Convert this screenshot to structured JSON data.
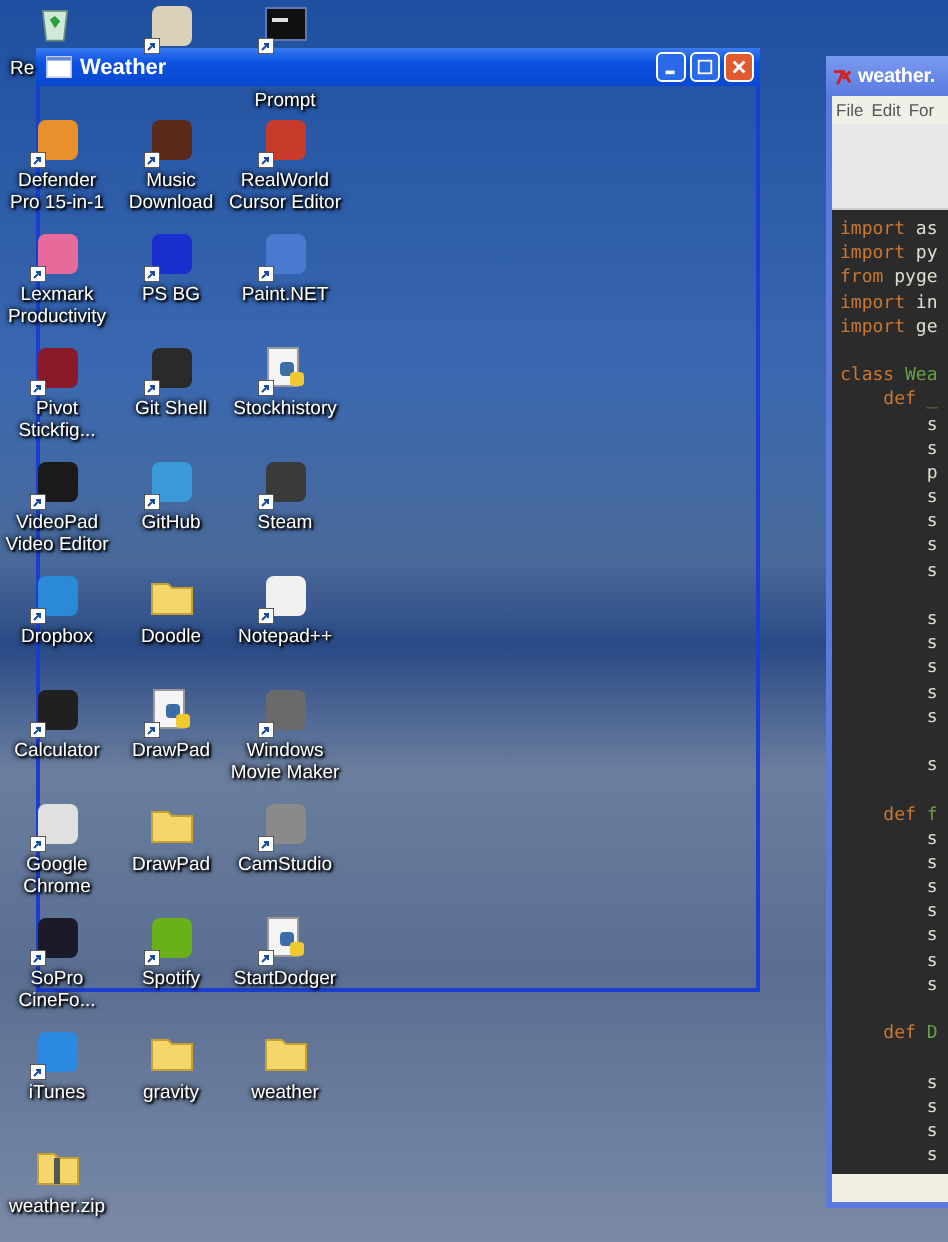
{
  "desktop": {
    "icons": [
      {
        "kind": "bin",
        "label": "Re"
      },
      {
        "kind": "app",
        "color": "#d9d2b8",
        "shortcut": true
      },
      {
        "kind": "console",
        "label": "Prompt",
        "shortcut": true
      },
      {
        "kind": "app",
        "label": "Defender Pro 15-in-1",
        "color": "#e8912c",
        "shortcut": true
      },
      {
        "kind": "app",
        "label": "Music Download",
        "color": "#5a2a1a",
        "shortcut": true
      },
      {
        "kind": "app",
        "label": "RealWorld Cursor Editor",
        "color": "#c83a2a",
        "shortcut": true
      },
      {
        "kind": "app",
        "label": "Lexmark Productivity",
        "color": "#e86a9a",
        "shortcut": true
      },
      {
        "kind": "app",
        "label": "PS BG",
        "color": "#1a2fd0",
        "shortcut": true
      },
      {
        "kind": "app",
        "label": "Paint.NET",
        "color": "#4a7ad0",
        "shortcut": true
      },
      {
        "kind": "app",
        "label": "Pivot Stickfig...",
        "color": "#8a1a2a",
        "shortcut": true
      },
      {
        "kind": "app",
        "label": "Git Shell",
        "color": "#2a2a2a",
        "shortcut": true
      },
      {
        "kind": "python",
        "label": "Stockhistory",
        "shortcut": true
      },
      {
        "kind": "app",
        "label": "VideoPad Video Editor",
        "color": "#1a1a1a",
        "shortcut": true
      },
      {
        "kind": "app",
        "label": "GitHub",
        "color": "#3a9ad8",
        "shortcut": true
      },
      {
        "kind": "app",
        "label": "Steam",
        "color": "#3a3a3a",
        "shortcut": true
      },
      {
        "kind": "app",
        "label": "Dropbox",
        "color": "#2a8ad8",
        "shortcut": true
      },
      {
        "kind": "folder",
        "label": "Doodle"
      },
      {
        "kind": "app",
        "label": "Notepad++",
        "color": "#f0f0f0",
        "shortcut": true
      },
      {
        "kind": "app",
        "label": "Calculator",
        "color": "#202020",
        "shortcut": true
      },
      {
        "kind": "python",
        "label": "DrawPad",
        "shortcut": true
      },
      {
        "kind": "app",
        "label": "Windows Movie Maker",
        "color": "#6a6a6a",
        "shortcut": true
      },
      {
        "kind": "app",
        "label": "Google Chrome",
        "color": "#e0e0e0",
        "shortcut": true
      },
      {
        "kind": "folder",
        "label": "DrawPad"
      },
      {
        "kind": "app",
        "label": "CamStudio",
        "color": "#8a8a8a",
        "shortcut": true
      },
      {
        "kind": "app",
        "label": "SoPro CineFo...",
        "color": "#1a1a2a",
        "shortcut": true
      },
      {
        "kind": "app",
        "label": "Spotify",
        "color": "#6ab01a",
        "shortcut": true
      },
      {
        "kind": "python",
        "label": "StartDodger",
        "shortcut": true
      },
      {
        "kind": "app",
        "label": "iTunes",
        "color": "#2a8ae0",
        "shortcut": true
      },
      {
        "kind": "folder",
        "label": "gravity"
      },
      {
        "kind": "folder",
        "label": "weather"
      },
      {
        "kind": "zip",
        "label": "weather.zip"
      }
    ]
  },
  "weather_window": {
    "title": "Weather"
  },
  "editor_window": {
    "title": "weather.",
    "menu": [
      "File",
      "Edit",
      "For"
    ],
    "lines": [
      {
        "kind": "code",
        "tokens": [
          {
            "text": "import",
            "kind": "keyword"
          },
          {
            "text": " as",
            "kind": "plain"
          }
        ]
      },
      {
        "kind": "code",
        "tokens": [
          {
            "text": "import",
            "kind": "keyword"
          },
          {
            "text": " py",
            "kind": "plain"
          }
        ]
      },
      {
        "kind": "code",
        "tokens": [
          {
            "text": "from",
            "kind": "keyword"
          },
          {
            "text": " pyge",
            "kind": "plain"
          }
        ]
      },
      {
        "kind": "code",
        "tokens": [
          {
            "text": "import",
            "kind": "keyword"
          },
          {
            "text": " in",
            "kind": "plain"
          }
        ]
      },
      {
        "kind": "code",
        "tokens": [
          {
            "text": "import",
            "kind": "keyword"
          },
          {
            "text": " ge",
            "kind": "plain"
          }
        ]
      },
      {
        "kind": "blank"
      },
      {
        "kind": "code",
        "tokens": [
          {
            "text": "class",
            "kind": "keyword"
          },
          {
            "text": " Wea",
            "kind": "name"
          }
        ]
      },
      {
        "kind": "code",
        "tokens": [
          {
            "text": "    def",
            "kind": "keyword"
          },
          {
            "text": " _",
            "kind": "name"
          }
        ]
      },
      {
        "kind": "code",
        "tokens": [
          {
            "text": "        s",
            "kind": "plain"
          }
        ]
      },
      {
        "kind": "code",
        "tokens": [
          {
            "text": "        s",
            "kind": "plain"
          }
        ]
      },
      {
        "kind": "code",
        "tokens": [
          {
            "text": "        p",
            "kind": "plain"
          }
        ]
      },
      {
        "kind": "code",
        "tokens": [
          {
            "text": "        s",
            "kind": "plain"
          }
        ]
      },
      {
        "kind": "code",
        "tokens": [
          {
            "text": "        s",
            "kind": "plain"
          }
        ]
      },
      {
        "kind": "code",
        "tokens": [
          {
            "text": "        s",
            "kind": "plain"
          }
        ]
      },
      {
        "kind": "code",
        "tokens": [
          {
            "text": "        s",
            "kind": "plain"
          }
        ]
      },
      {
        "kind": "blank"
      },
      {
        "kind": "code",
        "tokens": [
          {
            "text": "        s",
            "kind": "plain"
          }
        ]
      },
      {
        "kind": "code",
        "tokens": [
          {
            "text": "        s",
            "kind": "plain"
          }
        ]
      },
      {
        "kind": "code",
        "tokens": [
          {
            "text": "        s",
            "kind": "plain"
          }
        ]
      },
      {
        "kind": "code",
        "tokens": [
          {
            "text": "        s",
            "kind": "plain"
          }
        ]
      },
      {
        "kind": "code",
        "tokens": [
          {
            "text": "        s",
            "kind": "plain"
          }
        ]
      },
      {
        "kind": "blank"
      },
      {
        "kind": "code",
        "tokens": [
          {
            "text": "        s",
            "kind": "plain"
          }
        ]
      },
      {
        "kind": "blank"
      },
      {
        "kind": "code",
        "tokens": [
          {
            "text": "    def",
            "kind": "keyword"
          },
          {
            "text": " f",
            "kind": "name"
          }
        ]
      },
      {
        "kind": "code",
        "tokens": [
          {
            "text": "        s",
            "kind": "plain"
          }
        ]
      },
      {
        "kind": "code",
        "tokens": [
          {
            "text": "        s",
            "kind": "plain"
          }
        ]
      },
      {
        "kind": "code",
        "tokens": [
          {
            "text": "        s",
            "kind": "plain"
          }
        ]
      },
      {
        "kind": "code",
        "tokens": [
          {
            "text": "        s",
            "kind": "plain"
          }
        ]
      },
      {
        "kind": "code",
        "tokens": [
          {
            "text": "        s",
            "kind": "plain"
          }
        ]
      },
      {
        "kind": "code",
        "tokens": [
          {
            "text": "        s",
            "kind": "plain"
          }
        ]
      },
      {
        "kind": "code",
        "tokens": [
          {
            "text": "        s",
            "kind": "plain"
          }
        ]
      },
      {
        "kind": "blank"
      },
      {
        "kind": "code",
        "tokens": [
          {
            "text": "    def",
            "kind": "keyword"
          },
          {
            "text": " D",
            "kind": "name"
          }
        ]
      },
      {
        "kind": "blank"
      },
      {
        "kind": "code",
        "tokens": [
          {
            "text": "        s",
            "kind": "plain"
          }
        ]
      },
      {
        "kind": "code",
        "tokens": [
          {
            "text": "        s",
            "kind": "plain"
          }
        ]
      },
      {
        "kind": "code",
        "tokens": [
          {
            "text": "        s",
            "kind": "plain"
          }
        ]
      },
      {
        "kind": "code",
        "tokens": [
          {
            "text": "        s",
            "kind": "plain"
          }
        ]
      }
    ]
  }
}
